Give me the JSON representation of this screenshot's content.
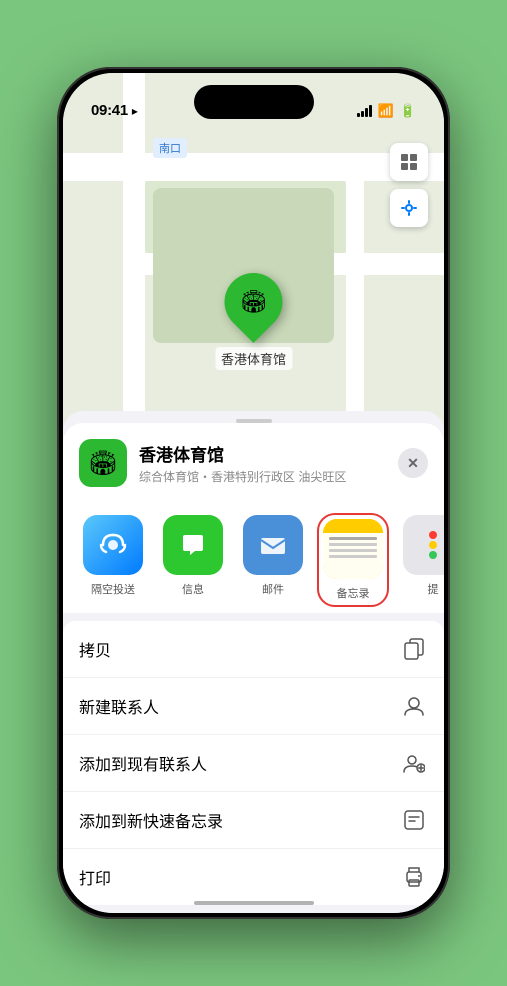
{
  "status_bar": {
    "time": "09:41",
    "location_arrow": "▶"
  },
  "map": {
    "label_north": "南口"
  },
  "pin": {
    "label": "香港体育馆",
    "icon": "🏟"
  },
  "sheet": {
    "venue_name": "香港体育馆",
    "venue_desc": "综合体育馆・香港特别行政区 油尖旺区",
    "close_label": "✕"
  },
  "share_items": [
    {
      "id": "airdrop",
      "label": "隔空投送",
      "icon_type": "airdrop"
    },
    {
      "id": "messages",
      "label": "信息",
      "icon_type": "messages"
    },
    {
      "id": "mail",
      "label": "邮件",
      "icon_type": "mail"
    },
    {
      "id": "notes",
      "label": "备忘录",
      "icon_type": "notes"
    },
    {
      "id": "more",
      "label": "提",
      "icon_type": "more"
    }
  ],
  "actions": [
    {
      "id": "copy",
      "label": "拷贝",
      "icon": "📋"
    },
    {
      "id": "new-contact",
      "label": "新建联系人",
      "icon": "👤"
    },
    {
      "id": "add-to-existing",
      "label": "添加到现有联系人",
      "icon": "👥"
    },
    {
      "id": "add-to-notes",
      "label": "添加到新快速备忘录",
      "icon": "📝"
    },
    {
      "id": "print",
      "label": "打印",
      "icon": "🖨"
    }
  ]
}
